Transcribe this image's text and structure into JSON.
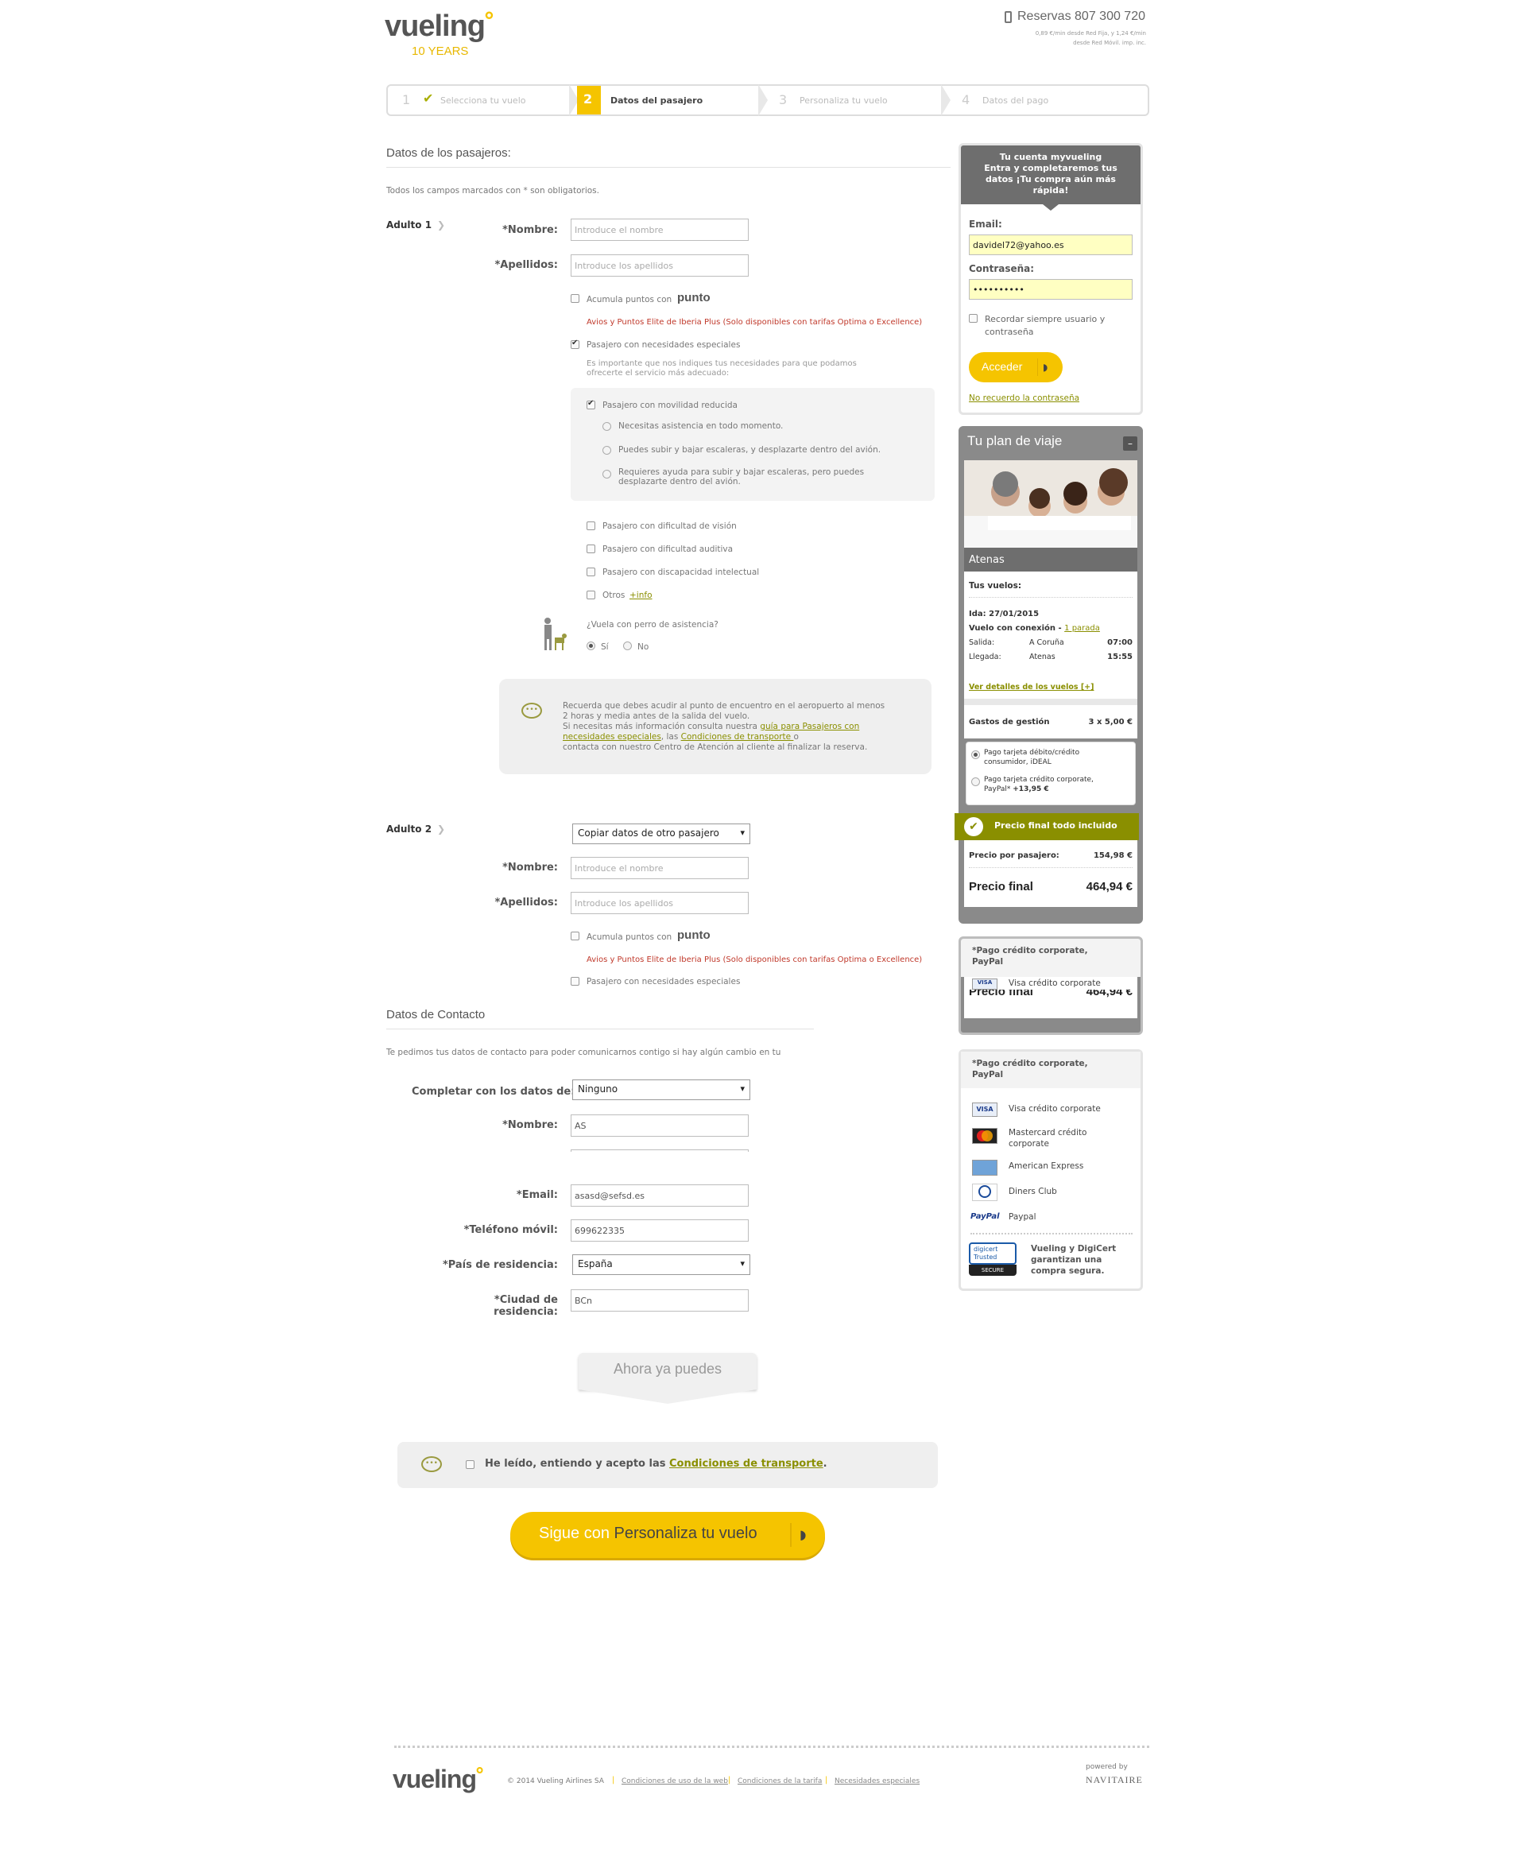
{
  "header": {
    "logo": "vueling",
    "logo_tag": "10 YEARS",
    "reservas": "Reservas 807 300 720",
    "reservas_note1": "0,89 €/min desde Red Fija, y 1,24 €/min",
    "reservas_note2": "desde Red Móvil. imp. inc."
  },
  "steps": [
    {
      "num": "1",
      "label": "Selecciona tu vuelo"
    },
    {
      "num": "2",
      "label": "Datos del pasajero"
    },
    {
      "num": "3",
      "label": "Personaliza tu vuelo"
    },
    {
      "num": "4",
      "label": "Datos del pago"
    }
  ],
  "passengers": {
    "title": "Datos de los pasajeros:",
    "required_note": "Todos los campos marcados con * son obligatorios.",
    "adult1": "Adulto 1",
    "adult2": "Adulto 2",
    "nombre_label": "*Nombre:",
    "apellidos_label": "*Apellidos:",
    "nombre_placeholder": "Introduce el nombre",
    "apellidos_placeholder": "Introduce los apellidos",
    "points_label": "Acumula puntos con",
    "points_brand": "punto",
    "avios_note": "Avios y Puntos Elite de Iberia Plus (Solo disponibles con tarifas Optima o Excellence)",
    "special_needs": "Pasajero con necesidades especiales",
    "special_note1": "Es importante que nos indiques tus necesidades para que podamos",
    "special_note2": "ofrecerte el servicio más adecuado:",
    "reduced_mobility": "Pasajero con movilidad reducida",
    "mob_opt1": "Necesitas asistencia en todo momento.",
    "mob_opt2": "Puedes subir y bajar escaleras, y desplazarte dentro del avión.",
    "mob_opt3a": "Requieres ayuda para subir y bajar escaleras, pero puedes",
    "mob_opt3b": "desplazarte dentro del avión.",
    "vision": "Pasajero con dificultad de visión",
    "hearing": "Pasajero con dificultad auditiva",
    "intellectual": "Pasajero con discapacidad intelectual",
    "others": "Otros",
    "others_link": "+info",
    "dog_question": "¿Vuela con perro de asistencia?",
    "dog_yes": "Sí",
    "dog_no": "No",
    "info1": "Recuerda que debes acudir al punto de encuentro en el aeropuerto al menos",
    "info2": "2 horas y media antes de la salida del vuelo.",
    "info3": "Si necesitas más información consulta nuestra ",
    "info3_link": "guía para Pasajeros con",
    "info4_link": "necesidades especiales",
    "info4_mid": ", las ",
    "info4_link2": "Condiciones de transporte ",
    "info4_end": " o",
    "info5": "contacta con nuestro Centro de Atención al cliente al finalizar la reserva.",
    "copy_select": "Copiar datos de otro pasajero"
  },
  "contact": {
    "title": "Datos de Contacto",
    "note": "Te pedimos tus datos de contacto para poder comunicarnos contigo si hay algún cambio en tu",
    "complete_label": "Completar con los datos de:",
    "complete_value": "Ninguno",
    "nombre_label": "*Nombre:",
    "nombre_value": "AS",
    "email_label": "*Email:",
    "email_value": "asasd@sefsd.es",
    "phone_label": "*Teléfono móvil:",
    "phone_value": "699622335",
    "country_label": "*País de residencia:",
    "country_value": "España",
    "city_label": "*Ciudad de residencia:",
    "city_value": "BCn"
  },
  "ahora": "Ahora ya puedes",
  "terms": {
    "text": "He leído, entiendo y acepto las ",
    "link": "Condiciones de transporte",
    "end": "."
  },
  "cta": {
    "prefix": "Sigue con ",
    "label": "Personaliza tu vuelo"
  },
  "login": {
    "header1": "Tu cuenta myvueling",
    "header2": "Entra y completaremos tus",
    "header3": "datos ¡Tu compra aún más",
    "header4": "rápida!",
    "email_label": "Email:",
    "email_value": "davidel72@yahoo.es",
    "password_label": "Contraseña:",
    "password_value": "••••••••••",
    "remember1": "Recordar siempre usuario y",
    "remember2": "contraseña",
    "button": "Acceder",
    "forgot": "No recuerdo la contraseña"
  },
  "plan": {
    "title": "Tu plan de viaje",
    "collapse": "–",
    "destination": "Atenas",
    "your_flights": "Tus vuelos:",
    "ida": "Ida: 27/01/2015",
    "connection": "Vuelo con conexión - ",
    "stops": "1 parada",
    "salida_label": "Salida:",
    "salida_city": "A Coruña",
    "salida_time": "07:00",
    "llegada_label": "Llegada:",
    "llegada_city": "Atenas",
    "llegada_time": "15:55",
    "details": "Ver detalles de los vuelos [+]",
    "fees_label": "Gastos de gestión",
    "fees_value": "3 x 5,00 €",
    "pay1a": "Pago tarjeta débito/crédito",
    "pay1b": "consumidor, iDEAL",
    "pay2a": "Pago tarjeta crédito corporate,",
    "pay2b": "PayPal* ",
    "pay2c": "+13,95 €",
    "final_banner": "Precio final todo incluido",
    "per_pax_label": "Precio por pasajero:",
    "per_pax_value": "154,98 €",
    "final_label": "Precio final",
    "final_value": "464,94 €"
  },
  "corp_box": {
    "title1": "*Pago crédito corporate,",
    "title2": "PayPal",
    "visa": "Visa crédito corporate",
    "mastercard1": "Mastercard crédito",
    "mastercard2": "corporate",
    "amex": "American Express",
    "diners": "Diners Club",
    "paypal": "Paypal",
    "paypal_logo": "PayPal",
    "digicert_badge": "digicert Trusted",
    "digicert_secure": "SECURE",
    "digicert1": "Vueling y DigiCert",
    "digicert2": "garantizan una",
    "digicert3": "compra segura.",
    "ghost_final": "Precio final",
    "ghost_value": "464,94 €"
  },
  "footer": {
    "logo": "vueling",
    "copyright": "© 2014 Vueling Airlines SA",
    "link1": "Condiciones de uso de la web",
    "link2": "Condiciones de la tarifa",
    "link3": "Necesidades especiales",
    "powered": "powered by",
    "navitaire": "NAVITAIRE"
  },
  "colors": {
    "yellow": "#f5c400",
    "olive": "#8a8f00",
    "dark": "#6e6e6e"
  }
}
